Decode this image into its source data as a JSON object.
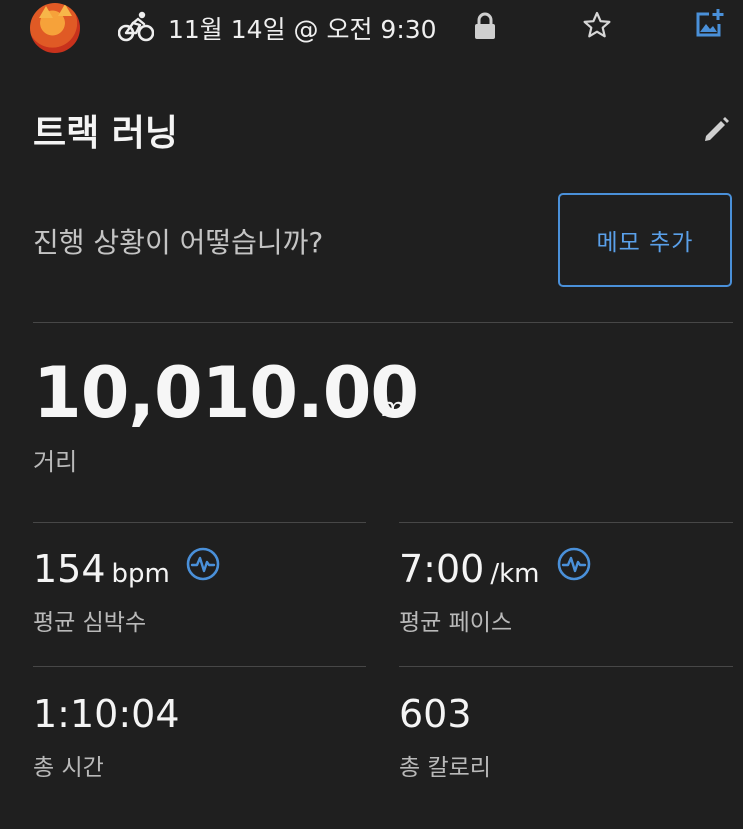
{
  "header": {
    "date_time": "11월 14일 @ 오전 9:30"
  },
  "activity": {
    "title": "트랙 러닝",
    "progress_prompt": "진행 상황이 어떻습니까?",
    "memo_button": "메모 추가"
  },
  "distance": {
    "value": "10,010.00",
    "unit": "m",
    "label": "거리"
  },
  "stats": {
    "avg_hr": {
      "value": "154",
      "unit": "bpm",
      "label": "평균 심박수"
    },
    "avg_pace": {
      "value": "7:00",
      "unit": "/km",
      "label": "평균 페이스"
    },
    "total_time": {
      "value": "1:10:04",
      "label": "총 시간"
    },
    "total_calories": {
      "value": "603",
      "label": "총 칼로리"
    }
  },
  "icons": {
    "activity_type": "cycling-icon",
    "privacy": "lock-icon",
    "favorite": "star-icon",
    "add_photo": "add-image-icon",
    "edit": "pencil-icon",
    "hr_badge": "heart-rate-icon"
  },
  "colors": {
    "background": "#1f1f1f",
    "accent": "#4a90d9"
  }
}
